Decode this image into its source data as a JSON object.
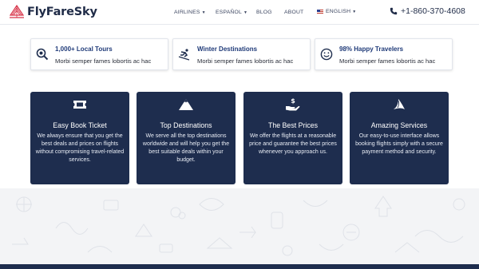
{
  "header": {
    "logo_text": "FlyFareSky",
    "nav": {
      "airlines": "AIRLINES",
      "espanol": "ESPAÑOL",
      "blog": "BLOG",
      "about": "ABOUT",
      "english": "ENGLISH"
    },
    "phone": "+1-860-370-4608"
  },
  "features": [
    {
      "icon": "search-icon",
      "title": "1,000+ Local Tours",
      "text": "Morbi semper fames lobortis ac hac"
    },
    {
      "icon": "skier-icon",
      "title": "Winter Destinations",
      "text": "Morbi semper fames lobortis ac hac"
    },
    {
      "icon": "smiley-icon",
      "title": "98% Happy Travelers",
      "text": "Morbi semper fames lobortis ac hac"
    }
  ],
  "cards": [
    {
      "icon": "ticket-icon",
      "title": "Easy Book Ticket",
      "text": "We always ensure that you get the best deals and prices on flights without compromising travel-related services."
    },
    {
      "icon": "mountain-icon",
      "title": "Top Destinations",
      "text": "We serve all the top destinations worldwide and will help you get the best suitable deals within your budget."
    },
    {
      "icon": "dollar-hand-icon",
      "title": "The Best Prices",
      "text": "We offer the flights at a reasonable price and guarantee the best prices whenever you approach us."
    },
    {
      "icon": "fin-icon",
      "title": "Amazing Services",
      "text": "Our easy-to-use interface allows booking flights simply with a secure payment method and security."
    }
  ],
  "colors": {
    "navy": "#1e2d4e",
    "accent_red": "#d8354a",
    "title_blue": "#1f3a78"
  }
}
